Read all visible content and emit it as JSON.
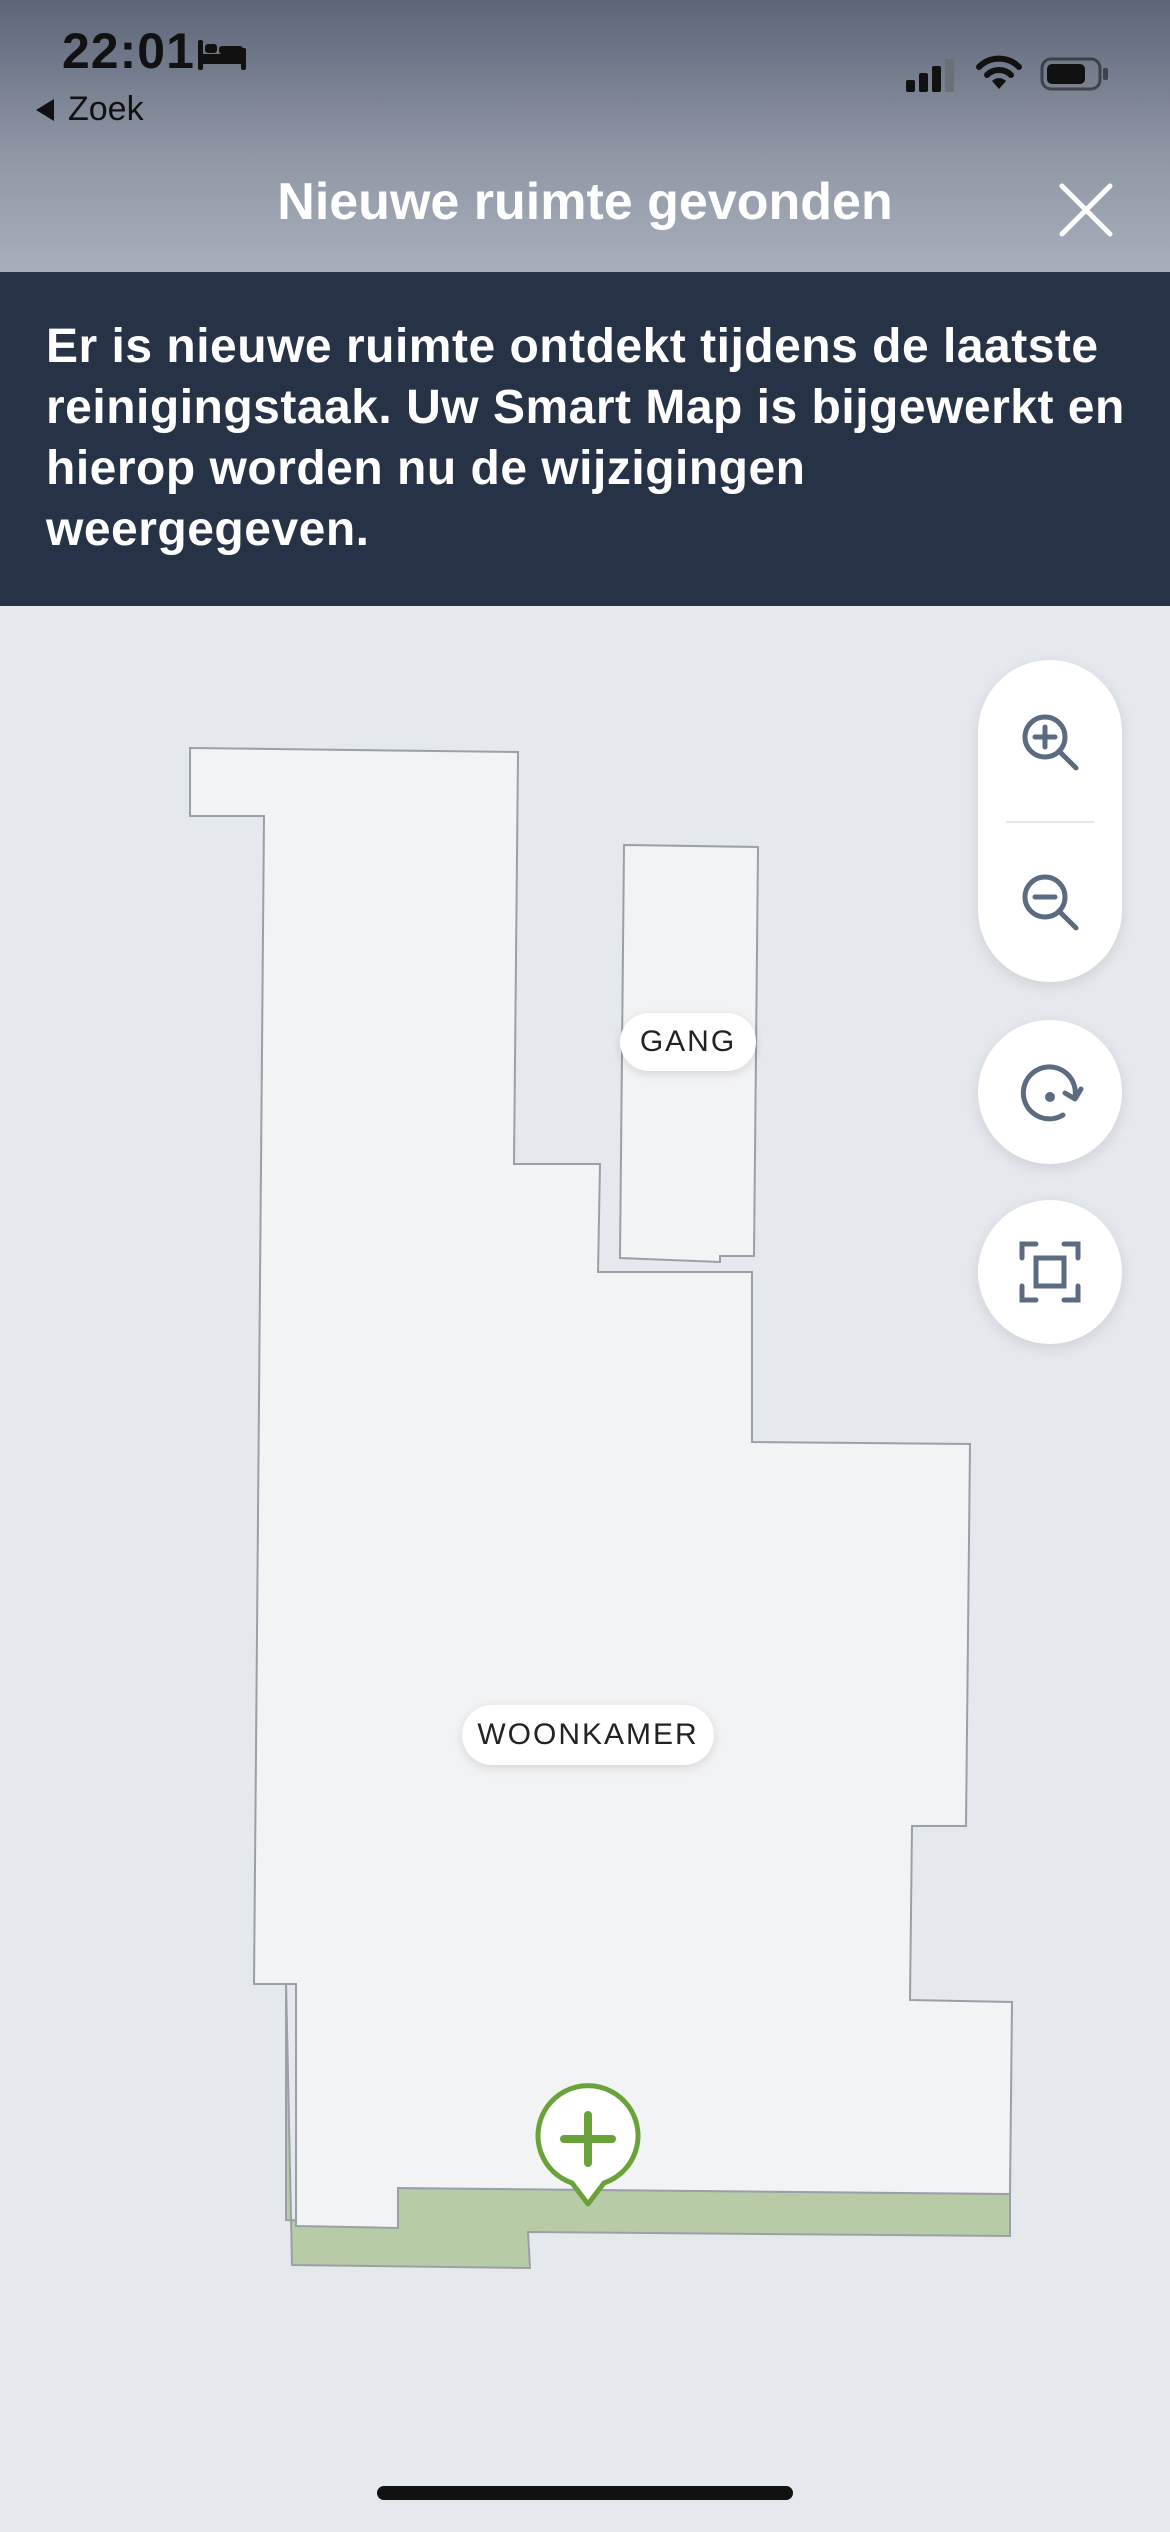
{
  "status_bar": {
    "time": "22:01",
    "back_label": "Zoek"
  },
  "nav": {
    "title": "Nieuwe ruimte gevonden"
  },
  "banner": {
    "message": "Er is nieuwe ruimte ontdekt tijdens de laatste reinigingstaak. Uw Smart Map is bijgewerkt en hierop worden nu de wijzigingen weergegeven."
  },
  "map": {
    "rooms": [
      {
        "label": "GANG"
      },
      {
        "label": "WOONKAMER"
      }
    ],
    "colors": {
      "floor": "#f2f3f5",
      "wall": "#9aa0a8",
      "new_area": "#b7cca6",
      "accent": "#6aa23a",
      "icon": "#5d6b80"
    }
  },
  "controls": {
    "zoom_in_icon": "zoom-in-icon",
    "zoom_out_icon": "zoom-out-icon",
    "rotate_icon": "rotate-icon",
    "fit_icon": "fit-screen-icon"
  }
}
